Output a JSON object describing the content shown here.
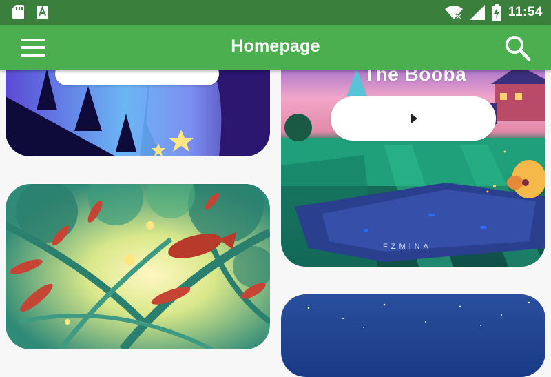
{
  "status_bar": {
    "time": "11:54",
    "icons": [
      "sd-card-icon",
      "text-app-icon",
      "wifi-icon",
      "signal-icon",
      "battery-charging-icon"
    ]
  },
  "app_bar": {
    "title": "Homepage",
    "menu_icon": "menu-icon",
    "search_icon": "search-icon"
  },
  "cards": [
    {
      "id": "night-forest",
      "title": "",
      "has_play_button": true
    },
    {
      "id": "the-booba",
      "title": "The Booba",
      "watermark": "FZMINA",
      "has_play_button": true
    },
    {
      "id": "fish-forest",
      "title": "",
      "has_play_button": false
    },
    {
      "id": "starry-night",
      "title": "",
      "has_play_button": false
    }
  ],
  "colors": {
    "status_bar": "#3a7f3b",
    "app_bar": "#4caf4f",
    "background": "#f7f7f7"
  }
}
